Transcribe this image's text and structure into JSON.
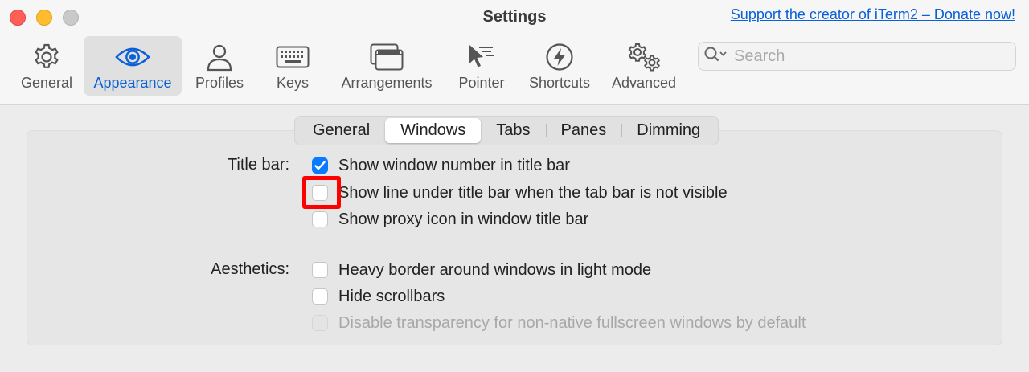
{
  "window": {
    "title": "Settings",
    "donate_link": "Support the creator of iTerm2 – Donate now!"
  },
  "toolbar": {
    "items": [
      {
        "label": "General",
        "icon": "gear-icon"
      },
      {
        "label": "Appearance",
        "icon": "eye-icon",
        "active": true
      },
      {
        "label": "Profiles",
        "icon": "person-icon"
      },
      {
        "label": "Keys",
        "icon": "keyboard-icon"
      },
      {
        "label": "Arrangements",
        "icon": "windows-icon"
      },
      {
        "label": "Pointer",
        "icon": "pointer-icon"
      },
      {
        "label": "Shortcuts",
        "icon": "bolt-icon"
      },
      {
        "label": "Advanced",
        "icon": "gears-icon"
      }
    ],
    "search_placeholder": "Search"
  },
  "tabs": {
    "items": [
      "General",
      "Windows",
      "Tabs",
      "Panes",
      "Dimming"
    ],
    "selected": "Windows"
  },
  "sections": {
    "title_bar": {
      "label": "Title bar:",
      "options": [
        {
          "label": "Show window number in title bar",
          "checked": true
        },
        {
          "label": "Show line under title bar when the tab bar is not visible",
          "checked": false
        },
        {
          "label": "Show proxy icon in window title bar",
          "checked": false
        }
      ]
    },
    "aesthetics": {
      "label": "Aesthetics:",
      "options": [
        {
          "label": "Heavy border around windows in light mode",
          "checked": false
        },
        {
          "label": "Hide scrollbars",
          "checked": false
        },
        {
          "label": "Disable transparency for non-native fullscreen windows by default",
          "checked": false,
          "disabled": true
        }
      ]
    }
  },
  "colors": {
    "accent": "#0a7aff",
    "link": "#0a60d6",
    "highlight": "#ff0000"
  }
}
